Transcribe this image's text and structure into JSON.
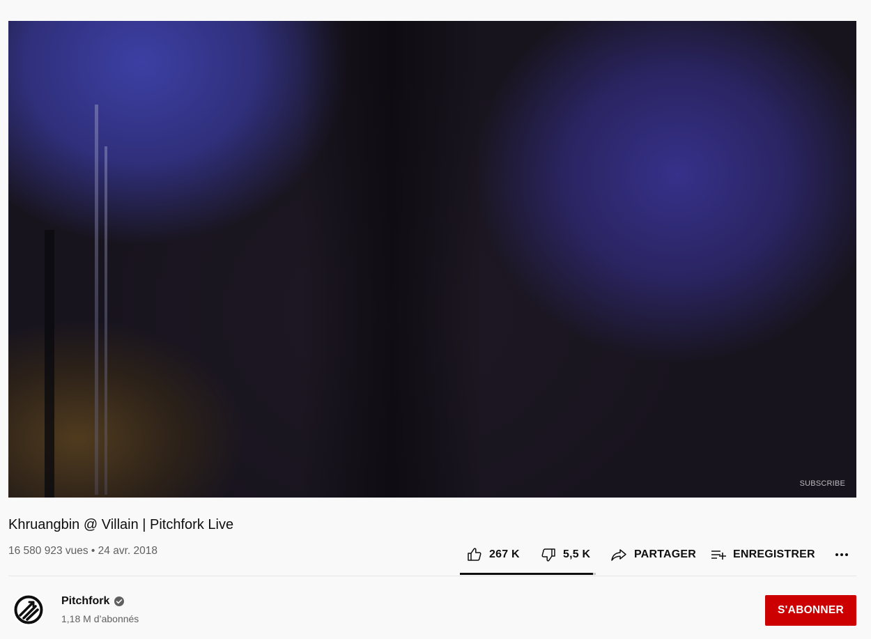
{
  "player": {
    "watermark_label": "SUBSCRIBE"
  },
  "video": {
    "title": "Khruangbin @ Villain | Pitchfork Live",
    "views": "16 580 923 vues",
    "separator": " • ",
    "date": "24 avr. 2018"
  },
  "actions": {
    "like_count": "267 K",
    "dislike_count": "5,5 K",
    "share_label": "PARTAGER",
    "save_label": "ENREGISTRER",
    "like_ratio": 0.98
  },
  "channel": {
    "name": "Pitchfork",
    "verified": true,
    "subscribers": "1,18 M d’abonnés",
    "subscribe_label": "S'ABONNER",
    "avatar_icon": "pitchfork-logo"
  },
  "colors": {
    "subscribe_button": "#cc0000",
    "text_primary": "#0f0f0f",
    "text_secondary": "#606060",
    "background": "#f9f9f9"
  }
}
